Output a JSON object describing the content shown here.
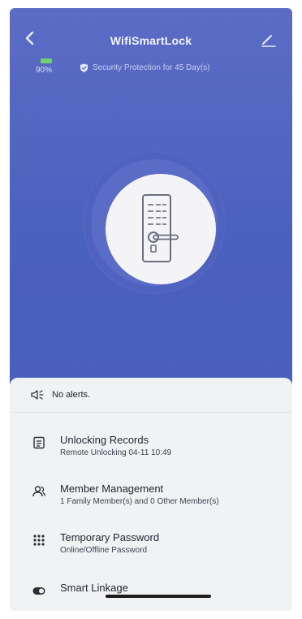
{
  "header": {
    "title": "WifiSmartLock",
    "battery_percent": 0.9,
    "battery_text": "90%",
    "security_text": "Security Protection for 45 Day(s)"
  },
  "alert": {
    "text": "No alerts."
  },
  "menu": [
    {
      "title": "Unlocking Records",
      "subtitle": "Remote Unlocking 04-11 10:49",
      "icon": "document-list-icon"
    },
    {
      "title": "Member Management",
      "subtitle": "1 Family Member(s) and 0 Other Member(s)",
      "icon": "people-icon"
    },
    {
      "title": "Temporary Password",
      "subtitle": "Online/Offline Password",
      "icon": "keypad-icon"
    },
    {
      "title": "Smart Linkage",
      "subtitle": "",
      "icon": "toggle-icon"
    }
  ],
  "colors": {
    "accent": "#4b61bf",
    "battery": "#6fd36a"
  }
}
